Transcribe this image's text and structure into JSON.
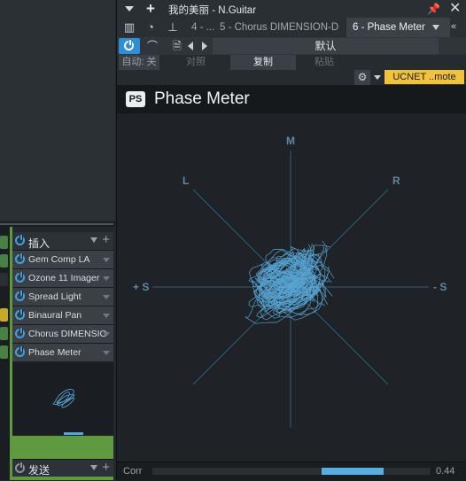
{
  "window": {
    "title": "我的美丽 - N.Guitar",
    "pin_icon": "pin-icon",
    "close_icon": "close-icon"
  },
  "tabs": [
    {
      "label": "4 - ..."
    },
    {
      "label": "5 - Chorus DIMENSION-D"
    },
    {
      "label": "6 - Phase Meter",
      "active": true
    }
  ],
  "tab_overflow": "«",
  "controls": {
    "preset": "默认",
    "auto_off": "自动: 关",
    "compare": "对照",
    "copy": "复制",
    "paste": "粘贴",
    "ucnet": "UCNET ..mote"
  },
  "plugin": {
    "logo_text": "PS",
    "name": "Phase Meter"
  },
  "scope": {
    "labels": {
      "m": "M",
      "l": "L",
      "r": "R",
      "left_s": "+ S",
      "right_s": "- S"
    },
    "axis_color": "#2d5d7a",
    "label_color": "#5b87a6",
    "trace_color": "#5fb6ea"
  },
  "footer": {
    "corr_label": "Corr",
    "corr_value": "0.44",
    "corr_value_num": 0.44
  },
  "inserts": {
    "header": "插入",
    "slots": [
      {
        "name": "Gem Comp LA"
      },
      {
        "name": "Ozone 11 Imager"
      },
      {
        "name": "Spread Light"
      },
      {
        "name": "Binaural Pan"
      },
      {
        "name": "Chorus DIMENSIO..."
      },
      {
        "name": "Phase Meter"
      }
    ]
  },
  "sends": {
    "header": "发送"
  },
  "colors": {
    "accent_blue": "#2f8fd6",
    "ucnet_yellow": "#f1c23a",
    "channel_green": "#5f9a40"
  }
}
